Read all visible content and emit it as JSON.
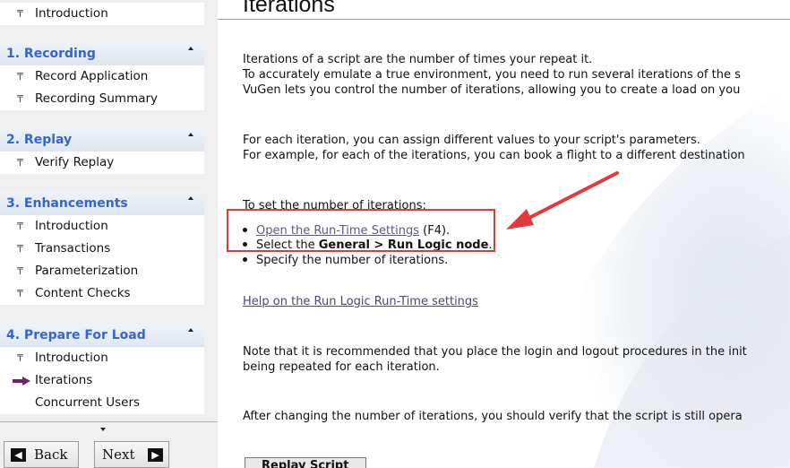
{
  "sidebar": {
    "top_item": "Introduction",
    "sections": [
      {
        "title": "1. Recording",
        "items": [
          "Record Application",
          "Recording Summary"
        ]
      },
      {
        "title": "2. Replay",
        "items": [
          "Verify Replay"
        ]
      },
      {
        "title": "3. Enhancements",
        "items": [
          "Introduction",
          "Transactions",
          "Parameterization",
          "Content Checks"
        ]
      },
      {
        "title": "4. Prepare For Load",
        "items": [
          "Introduction",
          "Iterations",
          "Concurrent Users"
        ],
        "current_item": "Iterations"
      }
    ],
    "back_label": "Back",
    "next_label": "Next"
  },
  "content": {
    "title": "Iterations",
    "para1": [
      "Iterations of a script are the number of times your repeat it.",
      "To accurately emulate a true environment, you need to run several iterations of the s",
      "VuGen lets you control the number of iterations, allowing you to create a load on you"
    ],
    "para2": [
      "For each iteration, you can assign different values to your script's parameters.",
      "For example, for each of the iterations, you can book a flight to a different destination"
    ],
    "steps_intro": "To set the number of iterations:",
    "step1_link": "Open the Run-Time Settings",
    "step1_suffix": " (F4).",
    "step2_prefix": "Select the ",
    "step2_bold": "General > Run Logic node",
    "step2_suffix": ".",
    "step3": "Specify the number of iterations.",
    "help_link": "Help on the Run Logic Run-Time settings",
    "note": [
      "Note that it is recommended that you place the login and logout procedures in the init",
      "being repeated for each iteration."
    ],
    "after": "After changing the number of iterations, you should verify that the script is still opera",
    "replay_button": "Replay Script"
  },
  "colors": {
    "section_title": "#3366cc",
    "callout": "#e23a3a",
    "current_arrow": "#7a1f6e"
  },
  "icons": {
    "item_pin": "pin-icon",
    "current": "arrow-right-icon",
    "back": "arrow-left-icon",
    "next": "arrow-right-icon"
  }
}
